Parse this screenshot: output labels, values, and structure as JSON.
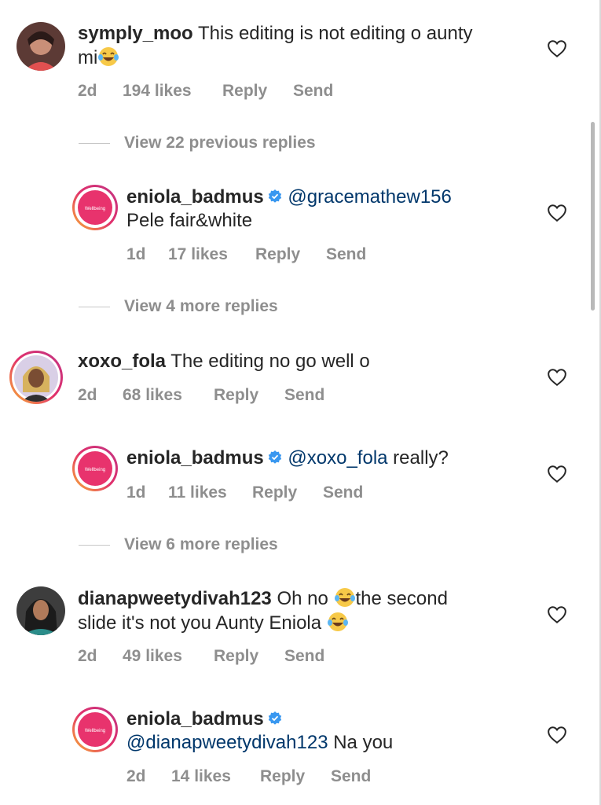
{
  "comments": [
    {
      "username": "symply_moo",
      "text_line1": "This editing is not editing o aunty",
      "text_line2": "mi",
      "time": "2d",
      "likes": "194 likes",
      "reply": "Reply",
      "send": "Send",
      "view_replies": "View 22 previous replies"
    },
    {
      "username": "eniola_badmus",
      "mention": "@gracemathew156",
      "text": "Pele fair&white",
      "time": "1d",
      "likes": "17 likes",
      "reply": "Reply",
      "send": "Send",
      "view_replies": "View 4 more replies"
    },
    {
      "username": "xoxo_fola",
      "text": "The editing no go well o",
      "time": "2d",
      "likes": "68 likes",
      "reply": "Reply",
      "send": "Send"
    },
    {
      "username": "eniola_badmus",
      "mention": "@xoxo_fola",
      "text": "really?",
      "time": "1d",
      "likes": "11 likes",
      "reply": "Reply",
      "send": "Send",
      "view_replies": "View 6 more replies"
    },
    {
      "username": "dianapweetydivah123",
      "text_a": "Oh no",
      "text_b": "the second",
      "text_line2": "slide it's not you Aunty Eniola",
      "time": "2d",
      "likes": "49 likes",
      "reply": "Reply",
      "send": "Send"
    },
    {
      "username": "eniola_badmus",
      "mention": "@dianapweetydivah123",
      "text": "Na you",
      "time": "2d",
      "likes": "14 likes",
      "reply": "Reply",
      "send": "Send"
    }
  ],
  "icons": {
    "like": "heart-outline-icon",
    "verified": "verified-badge-icon",
    "emoji": "tears-of-joy-emoji"
  },
  "colors": {
    "text": "#262626",
    "meta": "#8e8e8e",
    "mention": "#00376b",
    "verified": "#3897f0",
    "story_ring": "#e1306c"
  }
}
